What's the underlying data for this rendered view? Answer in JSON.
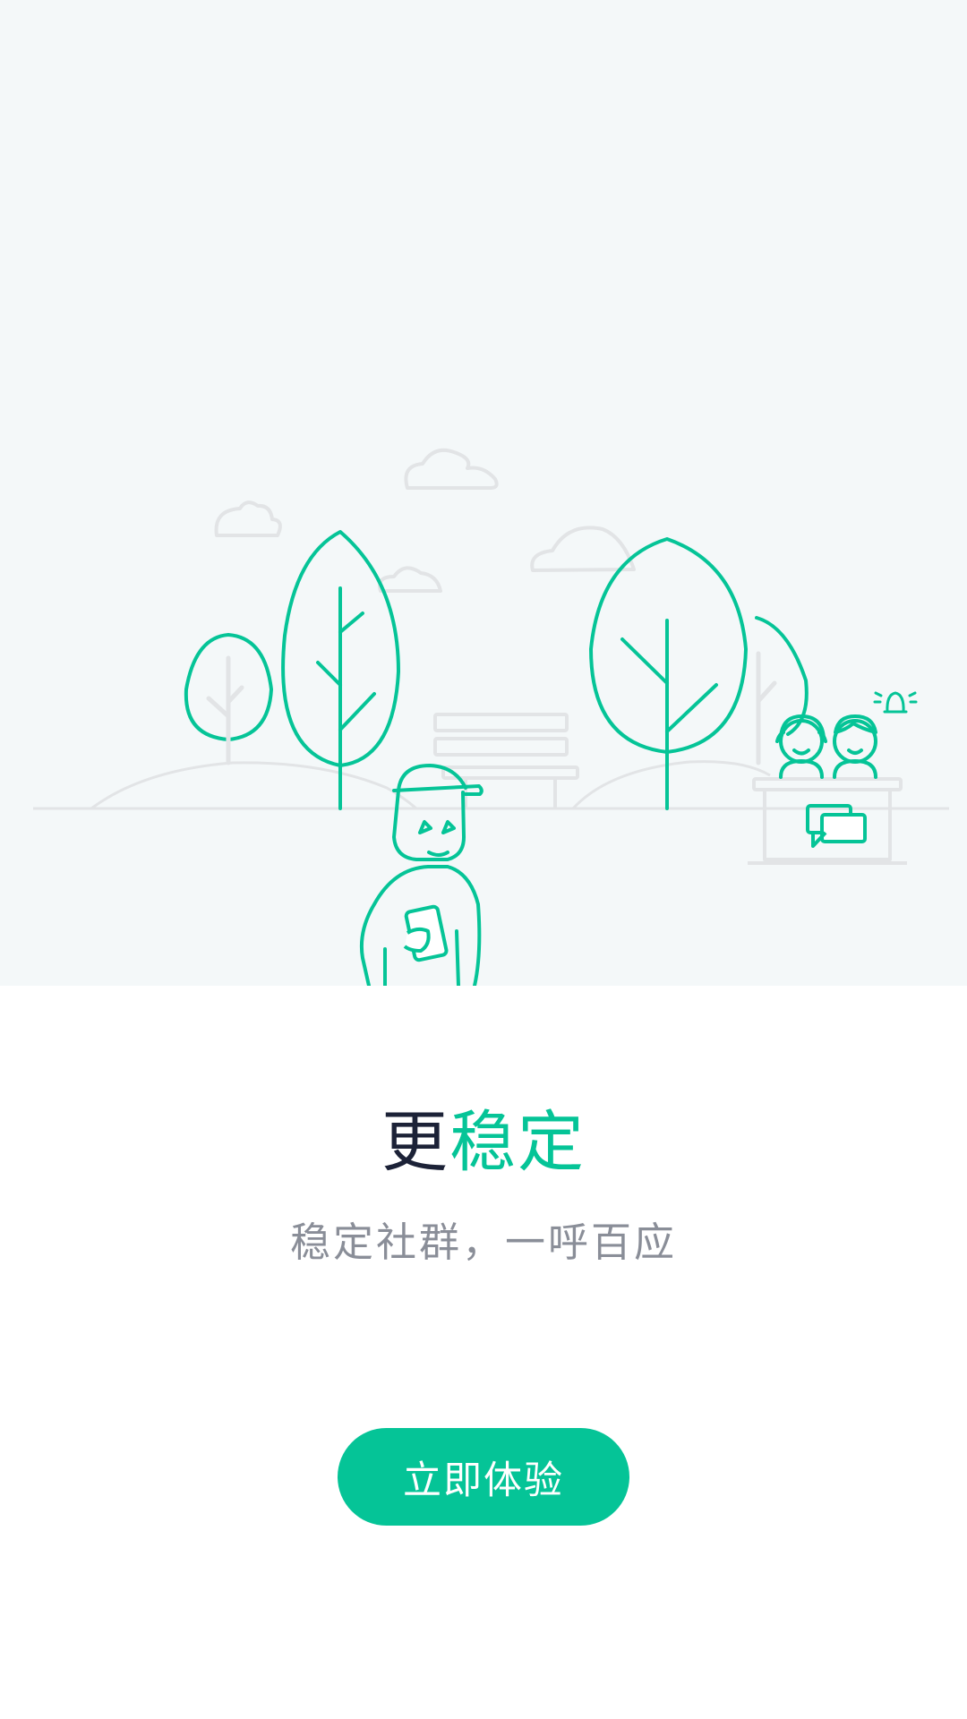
{
  "onboarding": {
    "title_part1": "更",
    "title_part2": "稳定",
    "subtitle": "稳定社群，一呼百应",
    "cta_label": "立即体验"
  },
  "illustration": {
    "scene": "park-with-user-and-support-desk",
    "icons": [
      "cloud-icon",
      "tree-icon",
      "bench-icon",
      "hill-icon",
      "user-figure-icon",
      "phone-icon",
      "support-agent-icon",
      "support-desk-icon",
      "chat-bubble-icon",
      "bell-icon"
    ]
  },
  "colors": {
    "accent": "#05c497",
    "title_dark": "#1c2237",
    "subtitle": "#8a8e98",
    "hero_background": "#f4f8f9",
    "line_gray": "#e2e4e6"
  }
}
